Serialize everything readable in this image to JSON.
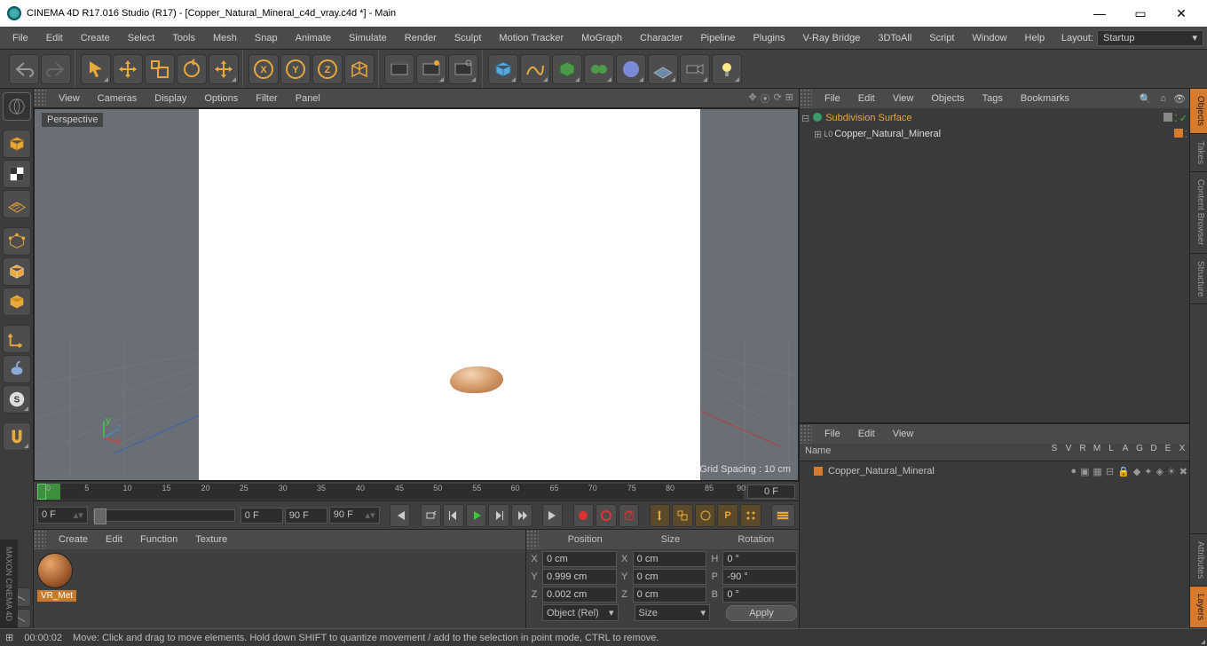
{
  "title": "CINEMA 4D R17.016 Studio (R17) - [Copper_Natural_Mineral_c4d_vray.c4d *] - Main",
  "menubar": [
    "File",
    "Edit",
    "Create",
    "Select",
    "Tools",
    "Mesh",
    "Snap",
    "Animate",
    "Simulate",
    "Render",
    "Sculpt",
    "Motion Tracker",
    "MoGraph",
    "Character",
    "Pipeline",
    "Plugins",
    "V-Ray Bridge",
    "3DToAll",
    "Script",
    "Window",
    "Help"
  ],
  "layout": {
    "label": "Layout:",
    "value": "Startup"
  },
  "viewport": {
    "menus": [
      "View",
      "Cameras",
      "Display",
      "Options",
      "Filter",
      "Panel"
    ],
    "label": "Perspective",
    "grid_text": "Grid Spacing : 10 cm"
  },
  "timeline": {
    "ticks": [
      "0",
      "5",
      "10",
      "15",
      "20",
      "25",
      "30",
      "35",
      "40",
      "45",
      "50",
      "55",
      "60",
      "65",
      "70",
      "75",
      "80",
      "85",
      "90"
    ],
    "current": "0 F",
    "start": "0 F",
    "inner_start": "0 F",
    "inner_end": "90 F",
    "end": "90 F"
  },
  "materials": {
    "menus": [
      "Create",
      "Edit",
      "Function",
      "Texture"
    ],
    "items": [
      {
        "name": "VR_Met"
      }
    ]
  },
  "coords": {
    "headers": [
      "Position",
      "Size",
      "Rotation"
    ],
    "rows": [
      {
        "axis": "X",
        "pos": "0 cm",
        "sizeAxis": "X",
        "size": "0 cm",
        "rotAxis": "H",
        "rot": "0 °"
      },
      {
        "axis": "Y",
        "pos": "0.999 cm",
        "sizeAxis": "Y",
        "size": "0 cm",
        "rotAxis": "P",
        "rot": "-90 °"
      },
      {
        "axis": "Z",
        "pos": "0.002 cm",
        "sizeAxis": "Z",
        "size": "0 cm",
        "rotAxis": "B",
        "rot": "0 °"
      }
    ],
    "mode": "Object (Rel)",
    "sizeMode": "Size",
    "apply": "Apply"
  },
  "objects": {
    "menus": [
      "File",
      "Edit",
      "View",
      "Objects",
      "Tags",
      "Bookmarks"
    ],
    "tree": [
      {
        "name": "Subdivision Surface",
        "level": 0,
        "sel": true,
        "icon": "subdiv"
      },
      {
        "name": "Copper_Natural_Mineral",
        "level": 1,
        "sel": false,
        "icon": "null"
      }
    ]
  },
  "attributes": {
    "menus": [
      "File",
      "Edit",
      "View"
    ],
    "nameLabel": "Name",
    "cols": [
      "S",
      "V",
      "R",
      "M",
      "L",
      "A",
      "G",
      "D",
      "E",
      "X"
    ],
    "row": {
      "name": "Copper_Natural_Mineral"
    }
  },
  "side_tabs": [
    "Objects",
    "Takes",
    "Content Browser",
    "Structure",
    "Attributes",
    "Layers"
  ],
  "status": {
    "time": "00:00:02",
    "hint": "Move: Click and drag to move elements. Hold down SHIFT to quantize movement / add to the selection in point mode, CTRL to remove."
  },
  "brand": "MAXON CINEMA 4D"
}
